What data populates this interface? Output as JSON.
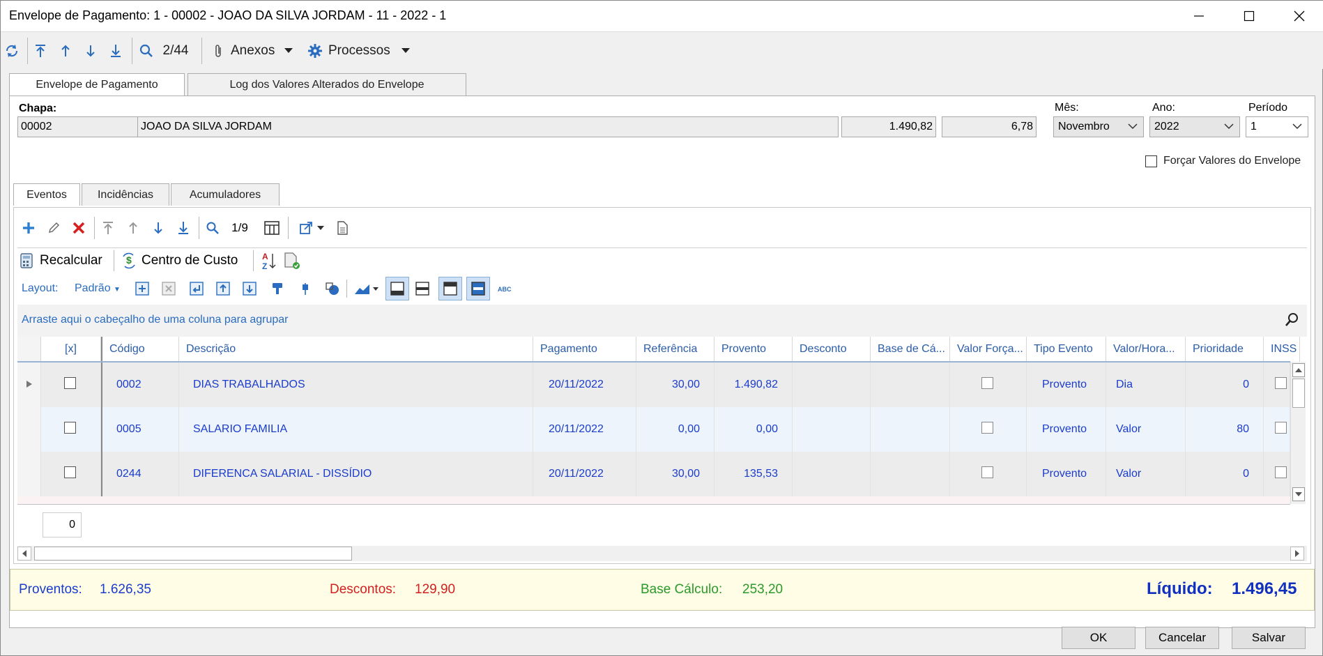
{
  "window": {
    "title": "Envelope de Pagamento: 1 - 00002 - JOAO DA SILVA JORDAM - 11 - 2022 - 1"
  },
  "toolbar": {
    "record_pos": "2/44",
    "anexos_label": "Anexos",
    "processos_label": "Processos"
  },
  "tabs": [
    "Envelope de Pagamento",
    "Log dos Valores Alterados do Envelope"
  ],
  "header": {
    "chapa_label": "Chapa:",
    "chapa_value": "00002",
    "name_value": "JOAO DA SILVA JORDAM",
    "value1": "1.490,82",
    "value2": "6,78",
    "mes_label": "Mês:",
    "mes_value": "Novembro",
    "ano_label": "Ano:",
    "ano_value": "2022",
    "periodo_label": "Período",
    "periodo_value": "1",
    "forcar_label": "Forçar Valores do Envelope"
  },
  "subtabs": [
    "Eventos",
    "Incidências",
    "Acumuladores"
  ],
  "grid_toolbar": {
    "record_pos": "1/9",
    "recalcular_label": "Recalcular",
    "centro_label": "Centro de Custo",
    "layout_label": "Layout:",
    "layout_value": "Padrão",
    "group_hint": "Arraste aqui o cabeçalho de uma coluna para agrupar"
  },
  "table": {
    "columns": [
      "[x]",
      "Código",
      "Descrição",
      "Pagamento",
      "Referência",
      "Provento",
      "Desconto",
      "Base de Cá...",
      "Valor Força...",
      "Tipo Evento",
      "Valor/Hora...",
      "Prioridade",
      "INSS"
    ],
    "rows": [
      {
        "codigo": "0002",
        "descricao": "DIAS TRABALHADOS",
        "pagamento": "20/11/2022",
        "referencia": "30,00",
        "provento": "1.490,82",
        "desconto": "",
        "base": "",
        "tipo": "Provento",
        "valor_hora": "Dia",
        "prioridade": "0"
      },
      {
        "codigo": "0005",
        "descricao": "SALARIO FAMILIA",
        "pagamento": "20/11/2022",
        "referencia": "0,00",
        "provento": "0,00",
        "desconto": "",
        "base": "",
        "tipo": "Provento",
        "valor_hora": "Valor",
        "prioridade": "80"
      },
      {
        "codigo": "0244",
        "descricao": "DIFERENCA SALARIAL - DISSÍDIO",
        "pagamento": "20/11/2022",
        "referencia": "30,00",
        "provento": "135,53",
        "desconto": "",
        "base": "",
        "tipo": "Provento",
        "valor_hora": "Valor",
        "prioridade": "0"
      }
    ],
    "footer_count": "0"
  },
  "totals": {
    "proventos_label": "Proventos:",
    "proventos_value": "1.626,35",
    "descontos_label": "Descontos:",
    "descontos_value": "129,90",
    "base_label": "Base Cálculo:",
    "base_value": "253,20",
    "liquido_label": "Líquido:",
    "liquido_value": "1.496,45"
  },
  "buttons": {
    "ok": "OK",
    "cancel": "Cancelar",
    "save": "Salvar"
  },
  "colors": {
    "accent": "#2a6cbf",
    "proventos": "#1a3ccc",
    "descontos": "#d02020",
    "base": "#2a9a2a",
    "liquido": "#1030c0"
  }
}
